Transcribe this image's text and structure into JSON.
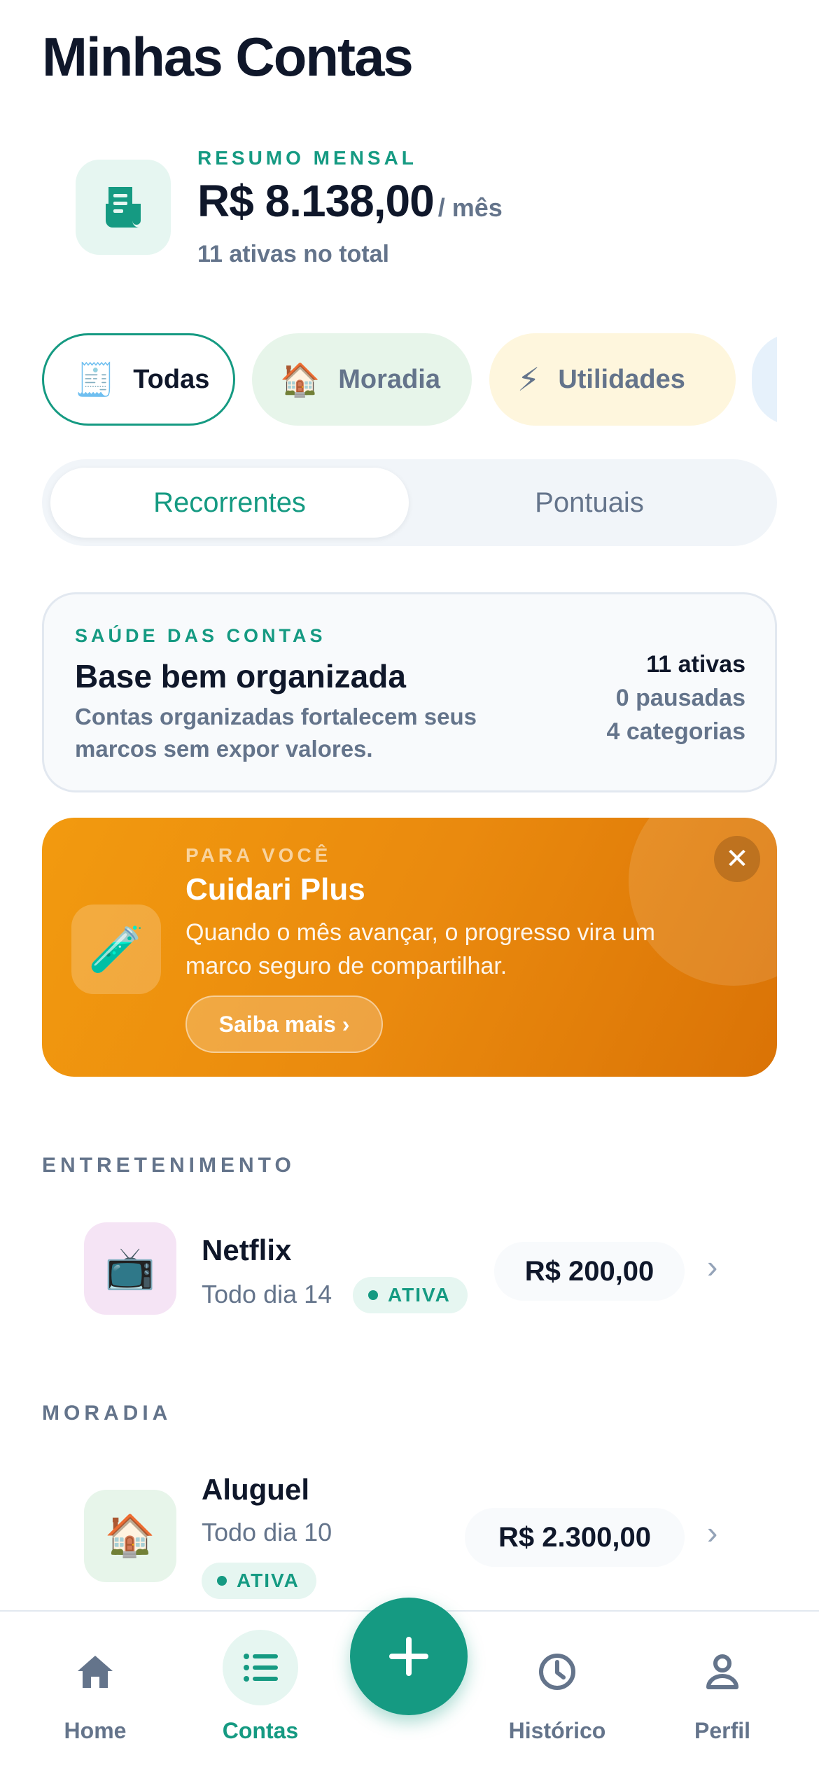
{
  "header": {
    "title": "Minhas Contas"
  },
  "summary": {
    "icon": "receipt-icon",
    "label": "RESUMO MENSAL",
    "amount": "R$ 8.138,00",
    "unit": "/ mês",
    "subtitle": "11 ativas no total"
  },
  "categories": [
    {
      "label": "Todas",
      "emoji": "🧾",
      "selected": true
    },
    {
      "label": "Moradia",
      "emoji": "🏠",
      "selected": false
    },
    {
      "label": "Utilidades",
      "emoji": "⚡",
      "selected": false
    }
  ],
  "tabs_segment": {
    "recurring": "Recorrentes",
    "one_time": "Pontuais",
    "selected": "Recorrentes"
  },
  "health": {
    "kicker": "SAÚDE DAS CONTAS",
    "title": "Base bem organizada",
    "description": "Contas organizadas fortalecem seus marcos sem expor valores.",
    "stats": {
      "active": "11 ativas",
      "paused": "0 pausadas",
      "categories": "4 categorias"
    }
  },
  "promo": {
    "kicker": "PARA VOCÊ",
    "title": "Cuidari Plus",
    "description": "Quando o mês avançar, o progresso vira um marco seguro de compartilhar.",
    "button": "Saiba mais ›",
    "icon": "🧪",
    "close": "✕"
  },
  "sections": [
    {
      "title": "ENTRETENIMENTO",
      "bills": [
        {
          "name": "Netflix",
          "due": "Todo dia 14",
          "status": "ATIVA",
          "amount": "R$ 200,00",
          "emoji": "📺",
          "icon_bg": "#f5e4f5"
        }
      ]
    },
    {
      "title": "MORADIA",
      "bills": [
        {
          "name": "Aluguel",
          "due": "Todo dia 10",
          "status": "ATIVA",
          "amount": "R$ 2.300,00",
          "emoji": "🏠",
          "icon_bg": "#e7f5ea"
        }
      ]
    }
  ],
  "tabbar": {
    "home": "Home",
    "accounts": "Contas",
    "history": "Histórico",
    "profile": "Perfil",
    "active": "Contas"
  },
  "colors": {
    "accent": "#159a82",
    "promo": "#ee8f0e",
    "text": "#0f172a",
    "muted": "#64748b"
  }
}
